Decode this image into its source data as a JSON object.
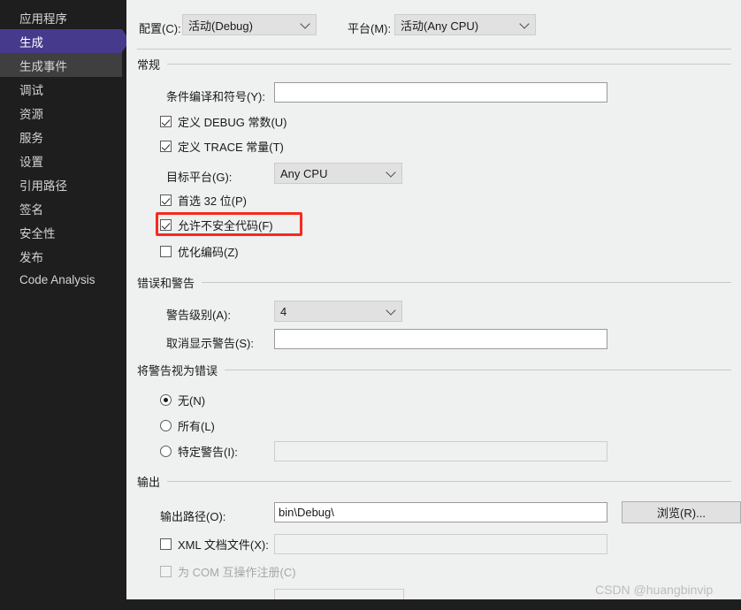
{
  "sidebar": {
    "items": [
      {
        "label": "应用程序",
        "state": "normal"
      },
      {
        "label": "生成",
        "state": "selected"
      },
      {
        "label": "生成事件",
        "state": "hover"
      },
      {
        "label": "调试",
        "state": "normal"
      },
      {
        "label": "资源",
        "state": "normal"
      },
      {
        "label": "服务",
        "state": "normal"
      },
      {
        "label": "设置",
        "state": "normal"
      },
      {
        "label": "引用路径",
        "state": "normal"
      },
      {
        "label": "签名",
        "state": "normal"
      },
      {
        "label": "安全性",
        "state": "normal"
      },
      {
        "label": "发布",
        "state": "normal"
      },
      {
        "label": "Code Analysis",
        "state": "normal"
      }
    ]
  },
  "top": {
    "configuration_label": "配置(C):",
    "configuration_value": "活动(Debug)",
    "platform_label": "平台(M):",
    "platform_value": "活动(Any CPU)"
  },
  "general": {
    "group_title": "常规",
    "cond_symbols_label": "条件编译和符号(Y):",
    "cond_symbols_value": "",
    "define_debug_label": "定义 DEBUG 常数(U)",
    "define_debug_checked": true,
    "define_trace_label": "定义 TRACE 常量(T)",
    "define_trace_checked": true,
    "target_platform_label": "目标平台(G):",
    "target_platform_value": "Any CPU",
    "prefer32_label": "首选 32 位(P)",
    "prefer32_checked": true,
    "unsafe_label": "允许不安全代码(F)",
    "unsafe_checked": true,
    "optimize_label": "优化编码(Z)",
    "optimize_checked": false
  },
  "errors": {
    "group_title": "错误和警告",
    "warning_level_label": "警告级别(A):",
    "warning_level_value": "4",
    "suppress_label": "取消显示警告(S):",
    "suppress_value": ""
  },
  "treat_warnings": {
    "group_title": "将警告视为错误",
    "none_label": "无(N)",
    "none_selected": true,
    "all_label": "所有(L)",
    "all_selected": false,
    "specific_label": "特定警告(I):",
    "specific_selected": false,
    "specific_value": ""
  },
  "output": {
    "group_title": "输出",
    "path_label": "输出路径(O):",
    "path_value": "bin\\Debug\\",
    "browse_label": "浏览(R)...",
    "xmldoc_label": "XML 文档文件(X):",
    "xmldoc_checked": false,
    "xmldoc_value": "",
    "com_label": "为 COM 互操作注册(C)",
    "com_checked": false,
    "com_disabled": true
  },
  "watermark": {
    "text": "CSDN @huangbinvip"
  },
  "colors": {
    "sidebar_bg": "#1e1e1e",
    "selected_purple": "#453a8c",
    "hover_gray": "#3f3f3f",
    "pane_bg": "#eff0f0",
    "highlight_red": "#f62b1e"
  }
}
